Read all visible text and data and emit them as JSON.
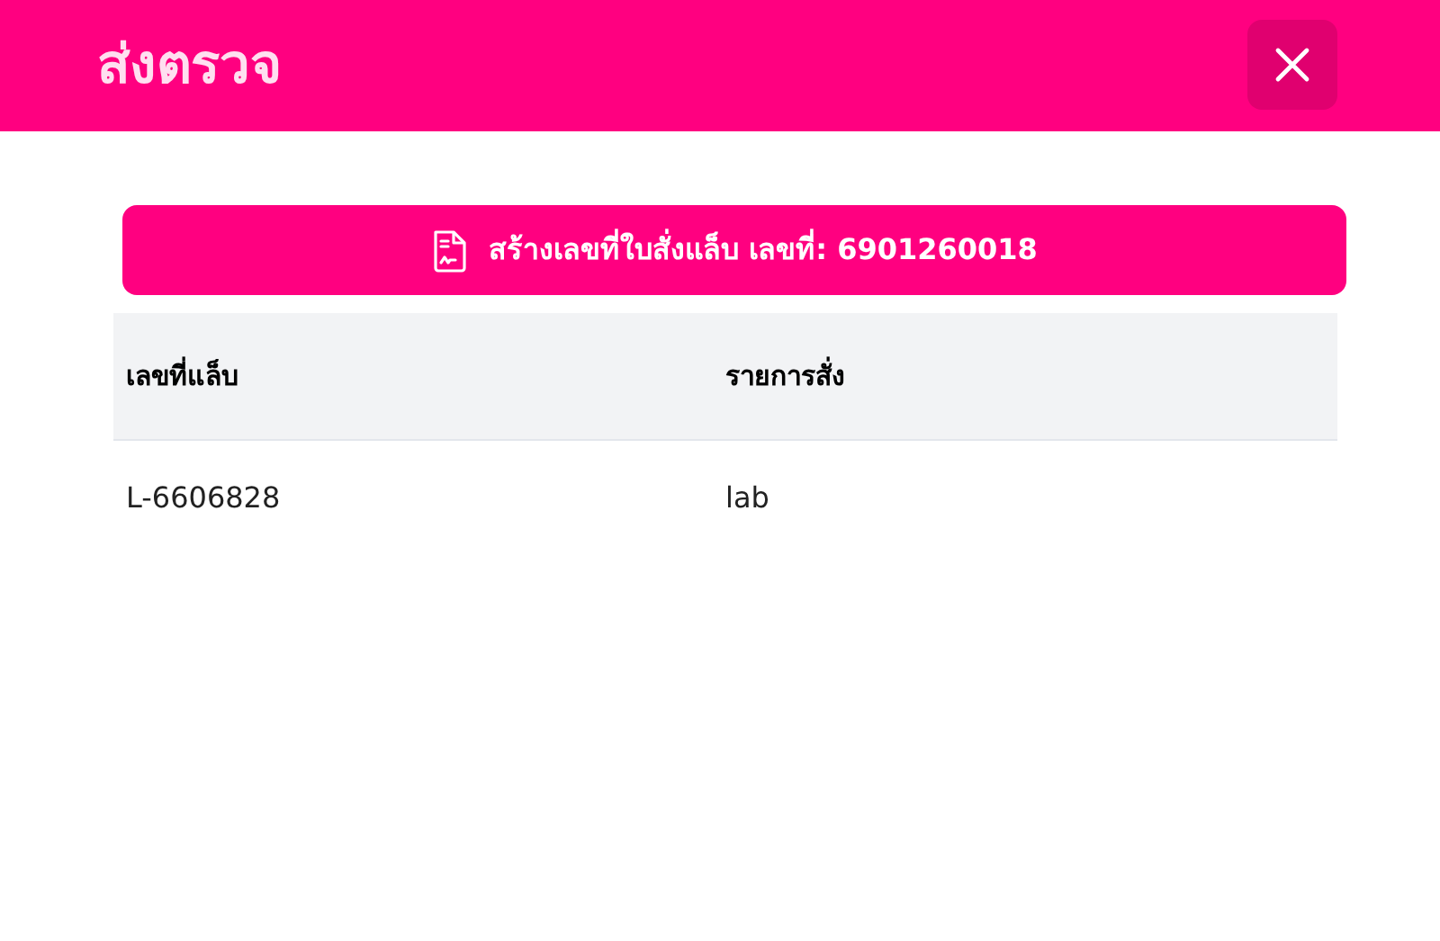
{
  "dialog": {
    "title": "ส่งตรวจ"
  },
  "create_button": {
    "label": "สร้างเลขที่ใบสั่งแล็บ เลขที่: 6901260018"
  },
  "table": {
    "columns": [
      "เลขที่แล็บ",
      "รายการสั่ง"
    ],
    "rows": [
      [
        "L-6606828",
        "lab"
      ]
    ]
  }
}
